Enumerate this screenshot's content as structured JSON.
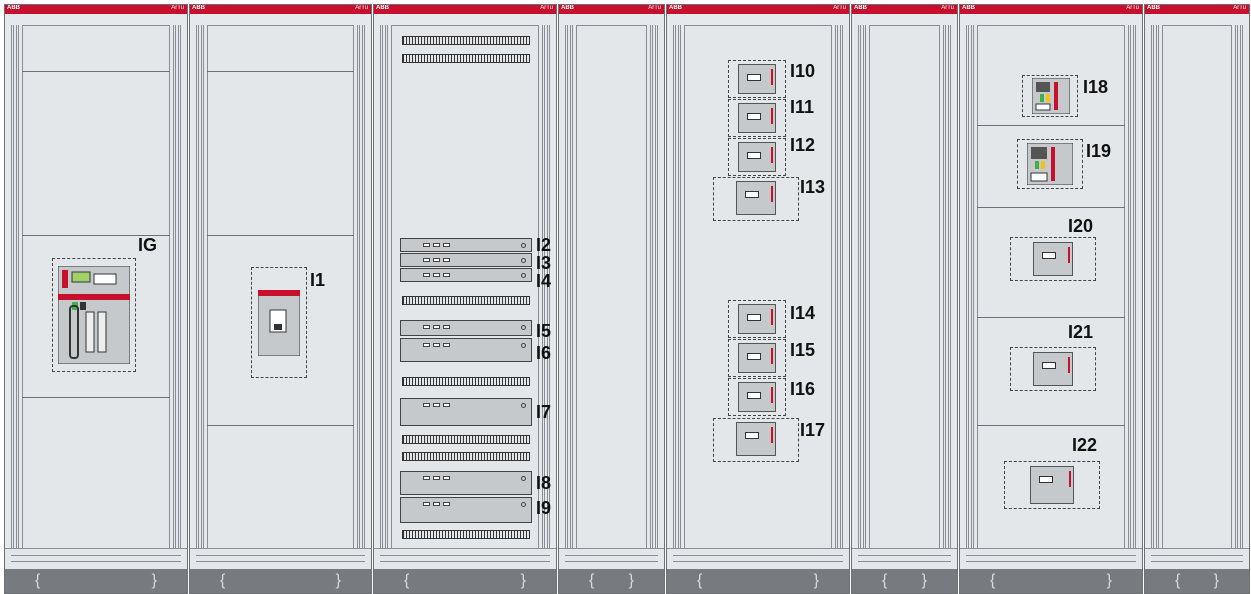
{
  "header": {
    "brand": "ABB",
    "series": "ArTu"
  },
  "labels": {
    "IG": "IG",
    "I1": "I1",
    "I2": "I2",
    "I3": "I3",
    "I4": "I4",
    "I5": "I5",
    "I6": "I6",
    "I7": "I7",
    "I8": "I8",
    "I9": "I9",
    "I10": "I10",
    "I11": "I11",
    "I12": "I12",
    "I13": "I13",
    "I14": "I14",
    "I15": "I15",
    "I16": "I16",
    "I17": "I17",
    "I18": "I18",
    "I19": "I19",
    "I20": "I20",
    "I21": "I21",
    "I22": "I22"
  },
  "colors": {
    "header_red": "#c8102e",
    "panel": "#e3e7ea",
    "plinth": "#777b80",
    "device": "#c6c9cc"
  }
}
